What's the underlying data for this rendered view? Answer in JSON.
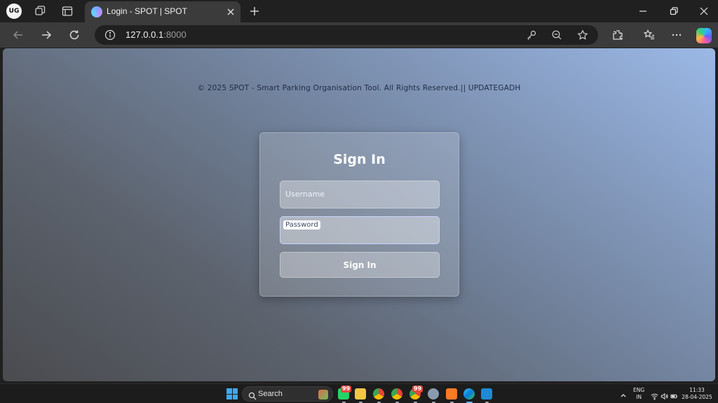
{
  "browser": {
    "profile_initials": "UG",
    "tab": {
      "title": "Login - SPOT | SPOT",
      "favicon": "spot-favicon"
    },
    "address": {
      "host": "127.0.0.1",
      "port": ":8000"
    }
  },
  "page": {
    "copyright": "© 2025 SPOT - Smart Parking Organisation Tool. All Rights Reserved.|| UPDATEGADH",
    "login": {
      "heading": "Sign In",
      "username_placeholder": "Username",
      "password_label": "Password",
      "submit_label": "Sign In"
    }
  },
  "taskbar": {
    "search_label": "Search",
    "apps": [
      {
        "name": "whatsapp",
        "badge": "99"
      },
      {
        "name": "file-explorer",
        "badge": ""
      },
      {
        "name": "chrome",
        "badge": ""
      },
      {
        "name": "chrome-profile-2",
        "badge": ""
      },
      {
        "name": "chrome-profile-3",
        "badge": "99"
      },
      {
        "name": "settings",
        "badge": ""
      },
      {
        "name": "xampp",
        "badge": ""
      },
      {
        "name": "edge",
        "badge": ""
      },
      {
        "name": "vscode",
        "badge": ""
      }
    ],
    "language": {
      "line1": "ENG",
      "line2": "IN"
    },
    "clock": {
      "time": "11:33",
      "date": "28-04-2025"
    }
  },
  "colors": {
    "accent": "#3fa9f5",
    "page_gradient_start": "#4a4b4f",
    "page_gradient_end": "#9bb8e6",
    "copyright_text": "#1e2b44"
  }
}
